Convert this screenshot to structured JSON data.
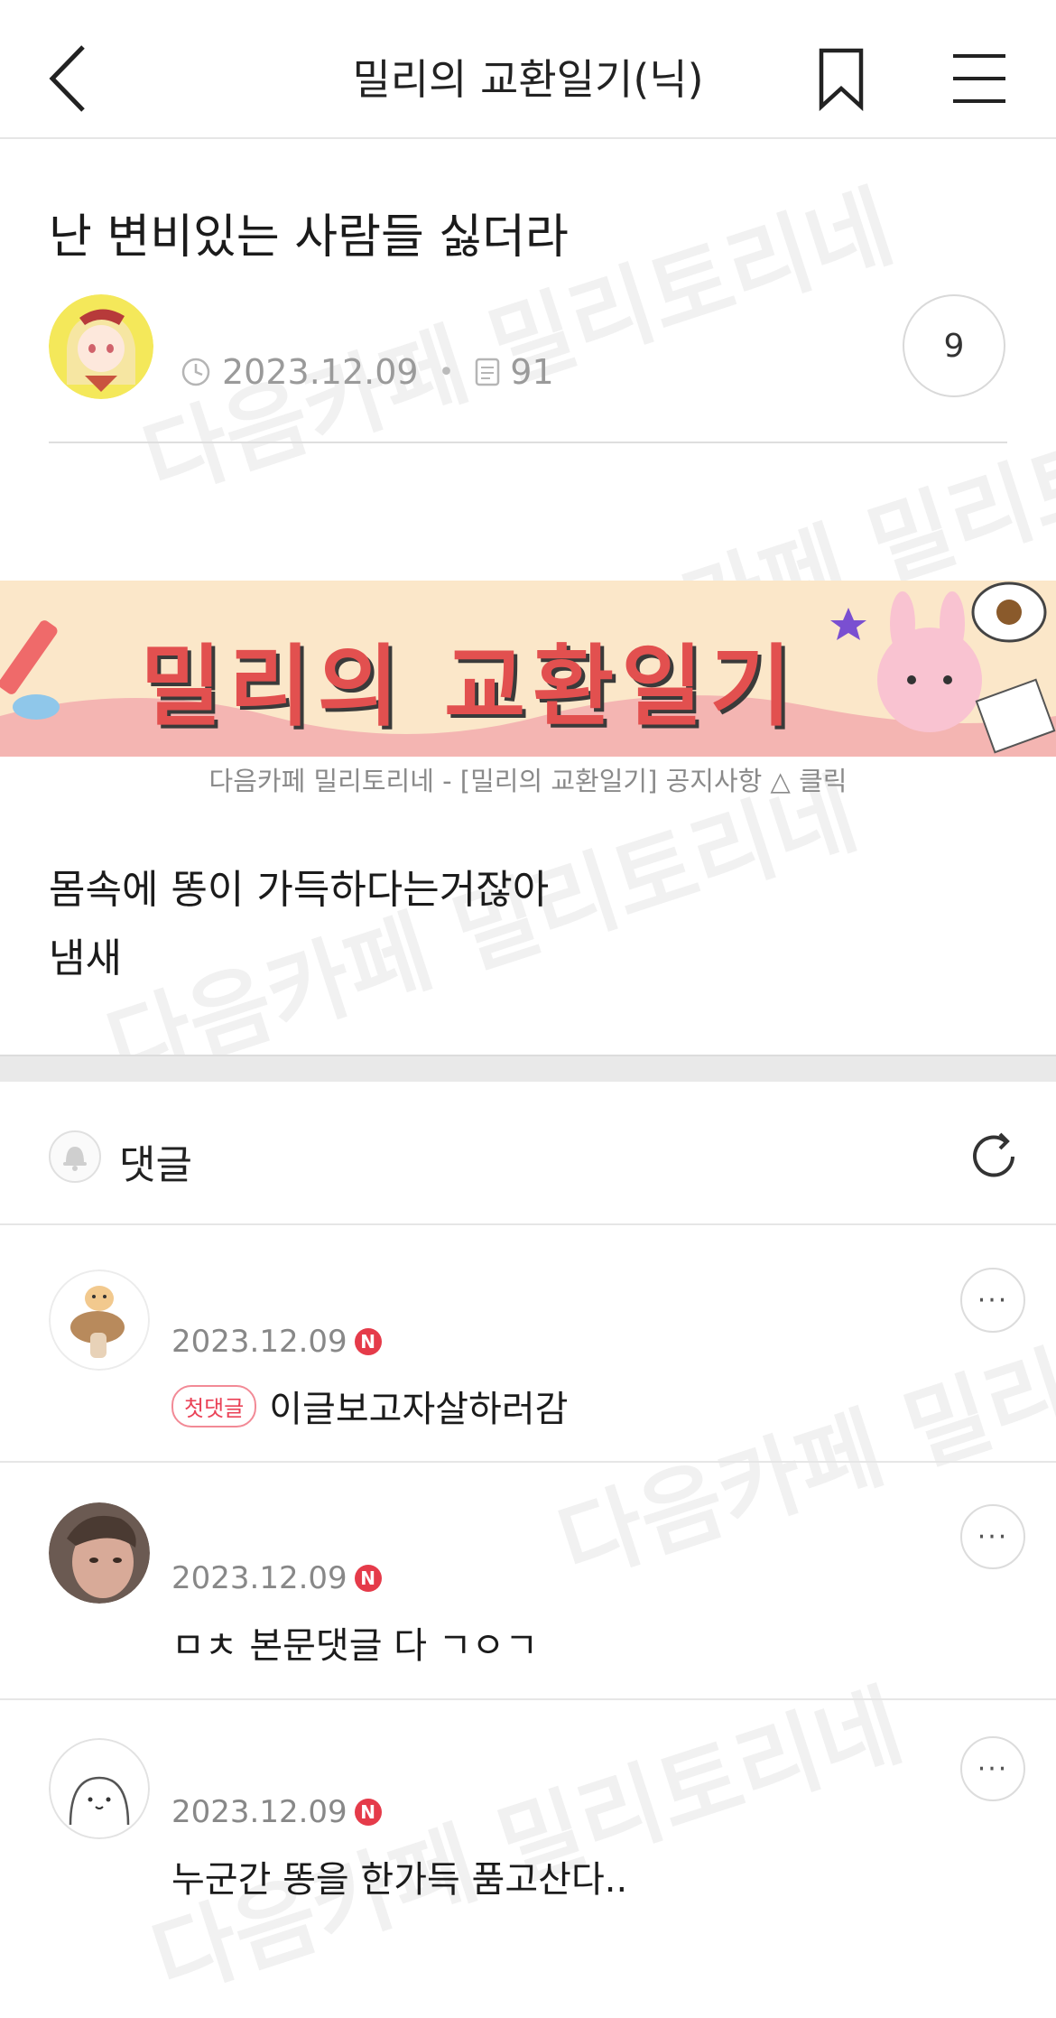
{
  "header": {
    "title": "밀리의 교환일기(닉)"
  },
  "post": {
    "title": "난 변비있는 사람들 싫더라",
    "date": "2023.12.09",
    "views": "91",
    "comment_count": "9",
    "banner_text": "밀리의 교환일기",
    "banner_caption": "다음카페 밀리토리네 - [밀리의 교환일기] 공지사항 △ 클릭",
    "body_lines": [
      "몸속에 똥이 가득하다는거잖아",
      "냄새"
    ]
  },
  "comments_section": {
    "label": "댓글",
    "items": [
      {
        "date": "2023.12.09",
        "new_badge": "N",
        "first_badge": "첫댓글",
        "text": "이글보고자살하러감"
      },
      {
        "date": "2023.12.09",
        "new_badge": "N",
        "text": "ㅁㅊ 본문댓글 다 ㄱㅇㄱ"
      },
      {
        "date": "2023.12.09",
        "new_badge": "N",
        "text": "누군간 똥을 한가득 품고산다.."
      }
    ],
    "more_label": "···"
  },
  "watermark": "다음카페 밀리토리네",
  "colors": {
    "new_badge": "#e53b4a",
    "first_badge": "#ea4257",
    "banner_bg": "#fbe7c9"
  }
}
